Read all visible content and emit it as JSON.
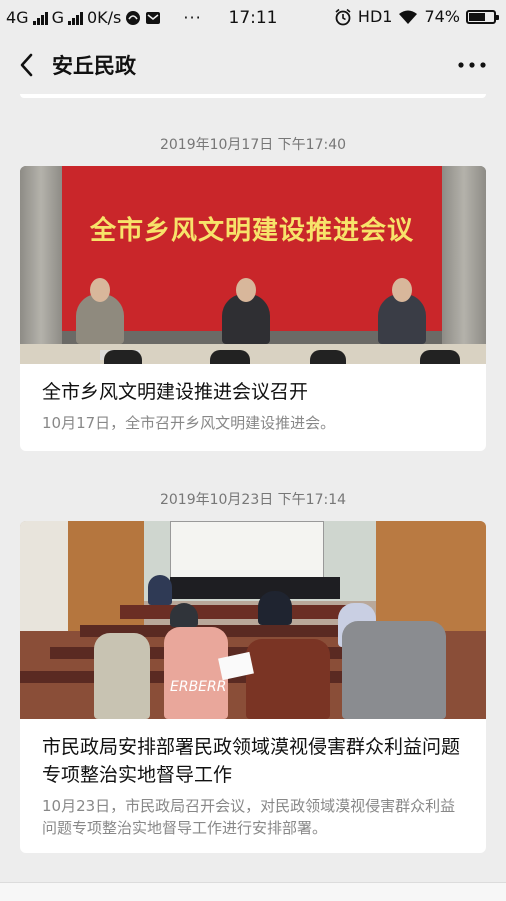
{
  "status_bar": {
    "network_1": "4G",
    "network_2": "G",
    "speed": "0K/s",
    "time": "17:11",
    "hd": "HD1",
    "battery_percent": "74%",
    "battery_level": 0.74
  },
  "nav": {
    "title": "安丘民政"
  },
  "articles": [
    {
      "timestamp": "2019年10月17日 下午17:40",
      "image_banner": "全市乡风文明建设推进会议",
      "title": "全市乡风文明建设推进会议召开",
      "summary": "10月17日，全市召开乡风文明建设推进会。"
    },
    {
      "timestamp": "2019年10月23日 下午17:14",
      "image_text": "ERBERR",
      "title": "市民政局安排部署民政领域漠视侵害群众利益问题专项整治实地督导工作",
      "summary": "10月23日，市民政局召开会议，对民政领域漠视侵害群众利益问题专项整治实地督导工作进行安排部署。"
    }
  ]
}
